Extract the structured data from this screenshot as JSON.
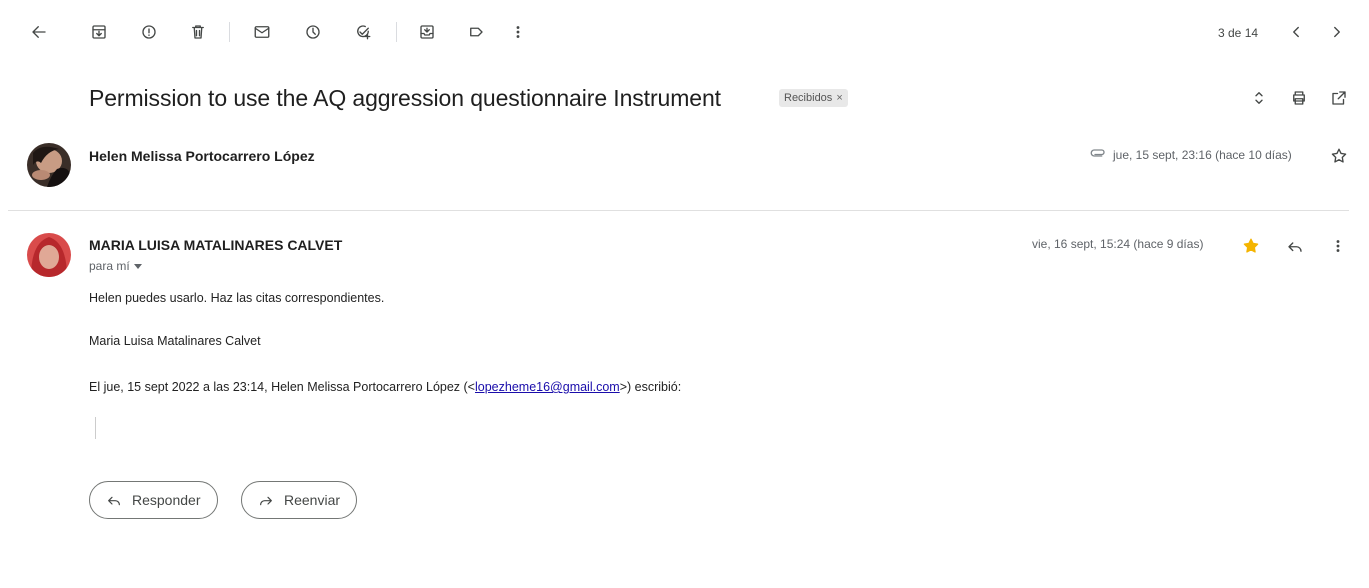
{
  "toolbar": {
    "icons": [
      "back-arrow-icon",
      "archive-icon",
      "report-spam-icon",
      "delete-icon",
      "mark-unread-icon",
      "snooze-icon",
      "add-task-icon",
      "move-to-icon",
      "labels-icon",
      "more-vert-icon"
    ],
    "counter": "3 de 14"
  },
  "thread": {
    "subject": "Permission to use the AQ aggression questionnaire Instrument",
    "label": "Recibidos",
    "label_close": "×"
  },
  "message1": {
    "sender": "Helen Melissa Portocarrero López",
    "date": "jue, 15 sept, 23:16 (hace 10 días)",
    "has_attachment": true,
    "starred": false
  },
  "message2": {
    "sender": "MARIA LUISA MATALINARES CALVET",
    "recipient": "para mí",
    "date": "vie, 16 sept, 15:24 (hace 9 días)",
    "starred": true,
    "star_color": "#f4b400",
    "body": {
      "line1": "Helen puedes usarlo. Haz las citas correspondientes.",
      "signature": "Maria Luisa Matalinares Calvet",
      "quote_prefix": "El jue, 15 sept 2022 a las 23:14, Helen Melissa Portocarrero López (<",
      "quote_email": "lopezheme16@gmail.com",
      "quote_suffix": ">) escribió:"
    }
  },
  "actions": {
    "reply": "Responder",
    "forward": "Reenviar"
  }
}
